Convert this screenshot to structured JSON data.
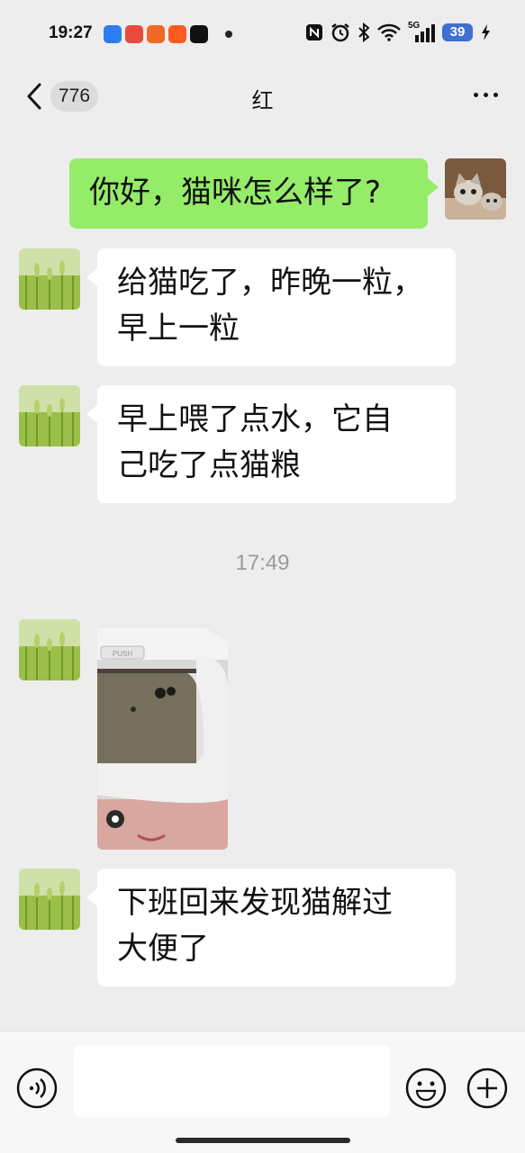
{
  "status_bar": {
    "time": "19:27",
    "app_icons": [
      "kugou-icon",
      "zhe-icon",
      "taobao-special-icon",
      "taobao-icon",
      "capcut-icon"
    ],
    "icons": [
      "nfc-icon",
      "alarm-icon",
      "bluetooth-icon",
      "wifi-icon",
      "signal-5g-icon",
      "charging-icon"
    ],
    "network": "5G",
    "battery": "39"
  },
  "nav": {
    "unread_count": "776",
    "title": "红"
  },
  "messages": [
    {
      "side": "out",
      "type": "text",
      "text": "你好，猫咪怎么样了?"
    },
    {
      "side": "in",
      "type": "text",
      "line1": "给猫吃了，昨晚一粒，",
      "line2": "早上一粒"
    },
    {
      "side": "in",
      "type": "text",
      "line1": "早上喂了点水，它自",
      "line2": "己吃了点猫粮"
    },
    {
      "side": "in",
      "type": "image",
      "label": "PUSH"
    },
    {
      "side": "in",
      "type": "text",
      "line1": "下班回来发现猫解过",
      "line2": "大便了"
    }
  ],
  "timestamp": "17:49",
  "colors": {
    "background": "#ededed",
    "outgoing_bubble": "#95ec69",
    "incoming_bubble": "#ffffff",
    "timestamp": "#9a9a9a"
  }
}
